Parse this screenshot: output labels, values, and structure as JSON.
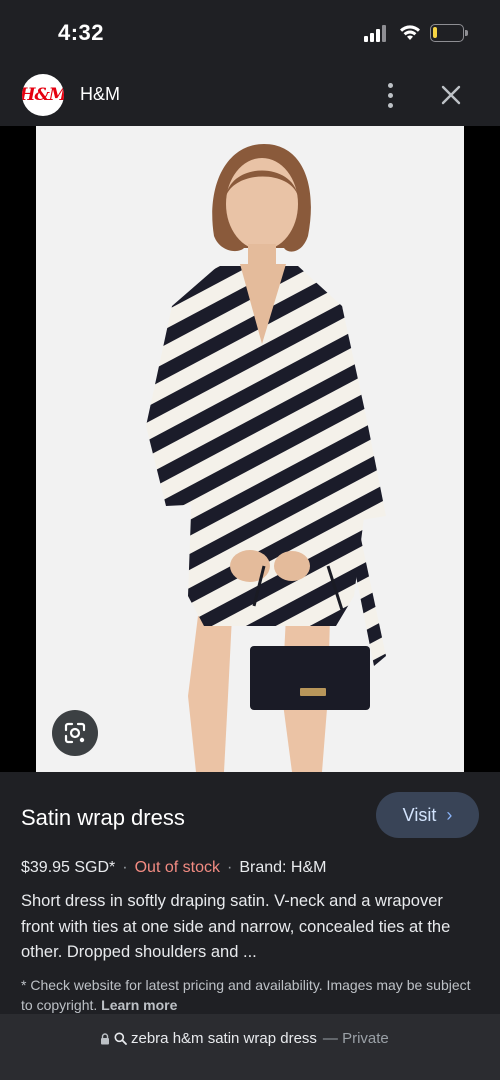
{
  "status_bar": {
    "time": "4:32",
    "signal_icon": "cellular-signal-icon",
    "wifi_icon": "wifi-icon",
    "battery_icon": "battery-icon",
    "battery_level": 0.15,
    "battery_color": "#f6d443"
  },
  "header": {
    "logo_text": "H&M",
    "site_name": "H&M",
    "logo_color": "#e50010",
    "more_icon": "more-vert-icon",
    "close_icon": "close-icon"
  },
  "image": {
    "lens_icon": "google-lens-icon"
  },
  "product": {
    "title": "Satin wrap dress",
    "visit_label": "Visit",
    "visit_icon": "chevron-right-icon",
    "price": "$39.95 SGD*",
    "separator": "·",
    "stock": "Out of stock",
    "brand": "Brand: H&M",
    "description": "Short dress in softly draping satin. V-neck and a wrapover front with ties at one side and narrow, concealed ties at the other. Dropped shoulders and ...",
    "disclaimer": "* Check website for latest pricing and availability. Images may be subject to copyright.",
    "learn_more": "Learn more",
    "stock_color": "#f28b82",
    "accent_color": "#8ab4f8"
  },
  "url_bar": {
    "query": "zebra h&m satin wrap dress",
    "suffix": "— Private",
    "lock_icon": "lock-icon",
    "search_icon": "search-icon"
  }
}
